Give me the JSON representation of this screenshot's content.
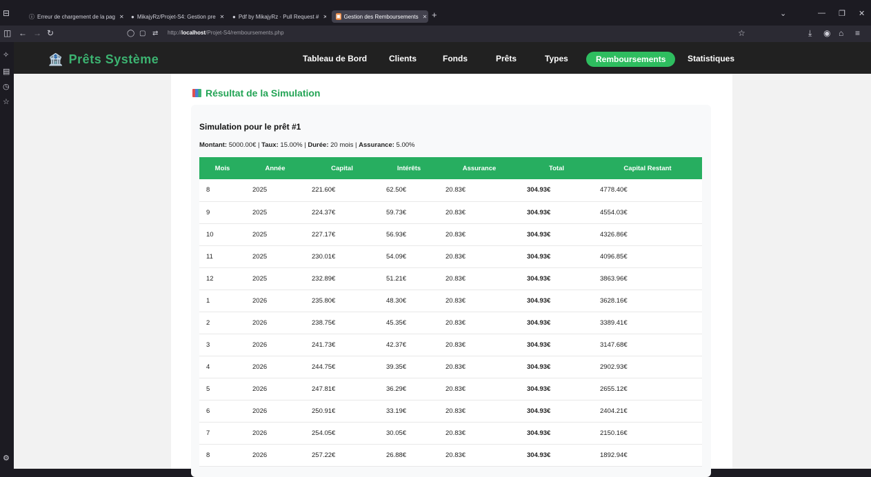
{
  "browser": {
    "tabs": [
      {
        "title": "Erreur de chargement de la pag"
      },
      {
        "title": "MikajyRz/Projet-S4: Gestion pre"
      },
      {
        "title": "Pdf by MikajyRz · Pull Request #"
      },
      {
        "title": "Gestion des Remboursements"
      }
    ],
    "url_prefix": "http://",
    "url_host": "localhost",
    "url_path": "/Projet-S4/remboursements.php"
  },
  "app": {
    "brand": "Prêts Système",
    "nav": [
      "Tableau de Bord",
      "Clients",
      "Fonds",
      "Prêts",
      "Types",
      "Remboursements",
      "Statistiques"
    ],
    "active_nav": "Remboursements"
  },
  "section": {
    "title": "Résultat de la Simulation",
    "sim_title": "Simulation pour le prêt #1",
    "montant_label": "Montant:",
    "montant": "5000.00€",
    "taux_label": "Taux:",
    "taux": "15.00%",
    "duree_label": "Durée:",
    "duree": "20 mois",
    "assurance_label": "Assurance:",
    "assurance": "5.00%"
  },
  "table": {
    "headers": [
      "Mois",
      "Année",
      "Capital",
      "Intérêts",
      "Assurance",
      "Total",
      "Capital Restant"
    ],
    "rows": [
      [
        "8",
        "2025",
        "221.60€",
        "62.50€",
        "20.83€",
        "304.93€",
        "4778.40€"
      ],
      [
        "9",
        "2025",
        "224.37€",
        "59.73€",
        "20.83€",
        "304.93€",
        "4554.03€"
      ],
      [
        "10",
        "2025",
        "227.17€",
        "56.93€",
        "20.83€",
        "304.93€",
        "4326.86€"
      ],
      [
        "11",
        "2025",
        "230.01€",
        "54.09€",
        "20.83€",
        "304.93€",
        "4096.85€"
      ],
      [
        "12",
        "2025",
        "232.89€",
        "51.21€",
        "20.83€",
        "304.93€",
        "3863.96€"
      ],
      [
        "1",
        "2026",
        "235.80€",
        "48.30€",
        "20.83€",
        "304.93€",
        "3628.16€"
      ],
      [
        "2",
        "2026",
        "238.75€",
        "45.35€",
        "20.83€",
        "304.93€",
        "3389.41€"
      ],
      [
        "3",
        "2026",
        "241.73€",
        "42.37€",
        "20.83€",
        "304.93€",
        "3147.68€"
      ],
      [
        "4",
        "2026",
        "244.75€",
        "39.35€",
        "20.83€",
        "304.93€",
        "2902.93€"
      ],
      [
        "5",
        "2026",
        "247.81€",
        "36.29€",
        "20.83€",
        "304.93€",
        "2655.12€"
      ],
      [
        "6",
        "2026",
        "250.91€",
        "33.19€",
        "20.83€",
        "304.93€",
        "2404.21€"
      ],
      [
        "7",
        "2026",
        "254.05€",
        "30.05€",
        "20.83€",
        "304.93€",
        "2150.16€"
      ],
      [
        "8",
        "2026",
        "257.22€",
        "26.88€",
        "20.83€",
        "304.93€",
        "1892.94€"
      ]
    ]
  }
}
